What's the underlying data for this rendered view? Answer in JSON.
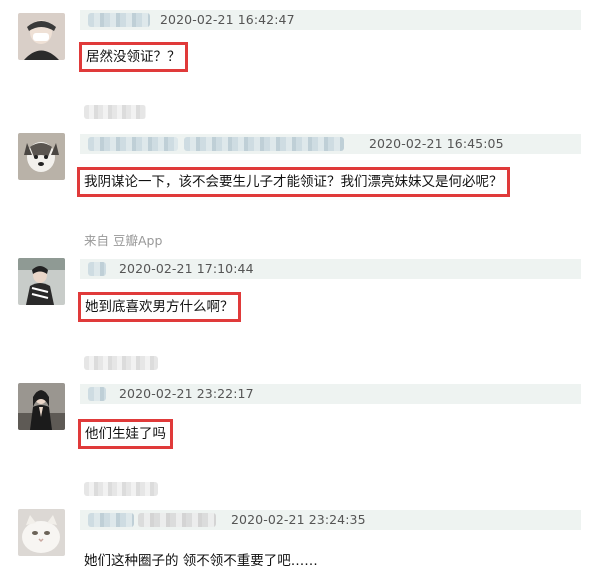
{
  "comments": [
    {
      "timestamp": "2020-02-21 16:42:47",
      "text": "居然没领证？？",
      "avatar_icon": "user-avatar-icon"
    },
    {
      "timestamp": "2020-02-21 16:45:05",
      "text": "我阴谋论一下，该不会要生儿子才能领证？我们漂亮妹妹又是何必呢？",
      "source": "来自 豆瓣App",
      "avatar_icon": "dog-avatar-icon"
    },
    {
      "timestamp": "2020-02-21 17:10:44",
      "text": "她到底喜欢男方什么啊？",
      "avatar_icon": "user-avatar-icon"
    },
    {
      "timestamp": "2020-02-21 23:22:17",
      "text": "他们生娃了吗",
      "avatar_icon": "user-avatar-icon"
    },
    {
      "timestamp": "2020-02-21 23:24:35",
      "text": "她们这种圈子的 领不领不重要了吧……",
      "avatar_icon": "cat-avatar-icon"
    }
  ],
  "colors": {
    "highlight_border": "#e03a3a",
    "header_bg": "#eef3f1",
    "timestamp": "#555555",
    "source": "#999999"
  }
}
